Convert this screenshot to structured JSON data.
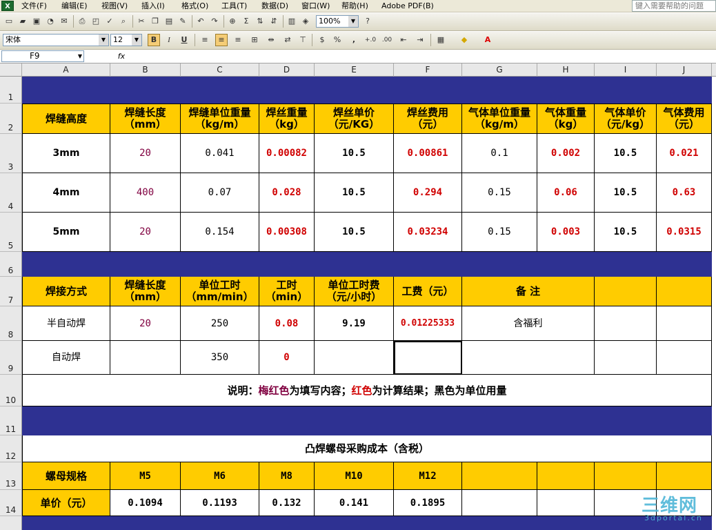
{
  "menu": {
    "app_icon": "X",
    "items": [
      "文件(F)",
      "编辑(E)",
      "视图(V)",
      "插入(I)",
      "格式(O)",
      "工具(T)",
      "数据(D)",
      "窗口(W)",
      "帮助(H)",
      "Adobe PDF(B)"
    ],
    "help_placeholder": "键入需要帮助的问题"
  },
  "toolbar": {
    "zoom": "100%",
    "font_name": "宋体",
    "font_size": "12",
    "bold": "B",
    "italic": "I",
    "underline": "U",
    "percent": "%",
    "comma": ","
  },
  "formula_bar": {
    "cell_ref": "F9",
    "fx": "fx"
  },
  "columns": [
    "A",
    "B",
    "C",
    "D",
    "E",
    "F",
    "G",
    "H",
    "I",
    "J"
  ],
  "rows": [
    "1",
    "2",
    "3",
    "4",
    "5",
    "6",
    "7",
    "8",
    "9",
    "10",
    "11",
    "12",
    "13",
    "14"
  ],
  "table1": {
    "headers": [
      [
        "焊缝高度",
        ""
      ],
      [
        "焊缝长度",
        "（mm）"
      ],
      [
        "焊缝单位重量",
        "（kg/m）"
      ],
      [
        "焊丝重量",
        "（kg）"
      ],
      [
        "焊丝单价",
        "（元/KG）"
      ],
      [
        "焊丝费用",
        "（元）"
      ],
      [
        "气体单位重量",
        "（kg/m）"
      ],
      [
        "气体重量",
        "（kg）"
      ],
      [
        "气体单价",
        "（元/kg）"
      ],
      [
        "气体费用",
        "（元）"
      ]
    ],
    "rows": [
      [
        "3mm",
        "20",
        "0.041",
        "0.00082",
        "10.5",
        "0.00861",
        "0.1",
        "0.002",
        "10.5",
        "0.021"
      ],
      [
        "4mm",
        "400",
        "0.07",
        "0.028",
        "10.5",
        "0.294",
        "0.15",
        "0.06",
        "10.5",
        "0.63"
      ],
      [
        "5mm",
        "20",
        "0.154",
        "0.00308",
        "10.5",
        "0.03234",
        "0.15",
        "0.003",
        "10.5",
        "0.0315"
      ]
    ]
  },
  "table2": {
    "headers": [
      [
        "焊接方式",
        ""
      ],
      [
        "焊缝长度",
        "（mm）"
      ],
      [
        "单位工时",
        "（mm/min）"
      ],
      [
        "工时",
        "（min）"
      ],
      [
        "单位工时费",
        "（元/小时）"
      ],
      [
        "工费（元）",
        ""
      ],
      [
        "备 注",
        ""
      ]
    ],
    "rows": [
      [
        "半自动焊",
        "20",
        "250",
        "0.08",
        "9.19",
        "0.01225333",
        "含福利"
      ],
      [
        "自动焊",
        "",
        "350",
        "0",
        "",
        "",
        ""
      ]
    ]
  },
  "note": {
    "prefix": "说明：",
    "magenta": "梅红色",
    "mid1": "为填写内容；",
    "red": "红色",
    "mid2": "为计算结果；黑色为单位用量"
  },
  "table3": {
    "title": "凸焊螺母采购成本（含税）",
    "spec_label": "螺母规格",
    "specs": [
      "M5",
      "M6",
      "M8",
      "M10",
      "M12"
    ],
    "price_label": "单价（元）",
    "prices": [
      "0.1094",
      "0.1193",
      "0.132",
      "0.141",
      "0.1895"
    ]
  },
  "watermark": {
    "main": "三维网",
    "sub": "3dportal.cn"
  },
  "colors": {
    "navy": "#2e3192",
    "gold": "#ffcc00",
    "magenta": "#800040",
    "red": "#d00000"
  }
}
